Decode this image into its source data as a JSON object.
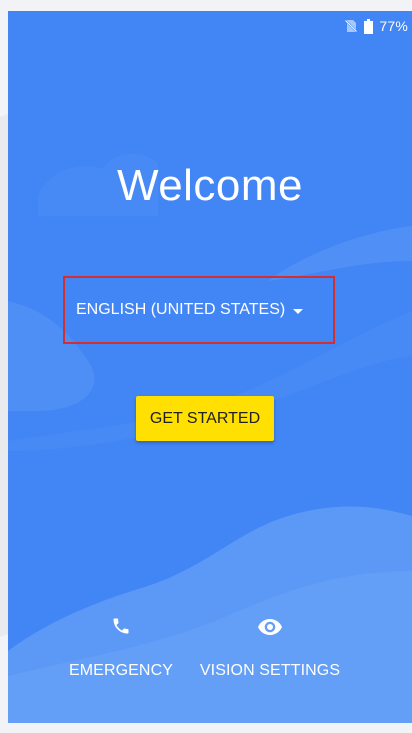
{
  "status_bar": {
    "icons": [
      "no-sim-icon",
      "battery-icon"
    ],
    "battery_percent": "77%"
  },
  "welcome": {
    "title": "Welcome"
  },
  "language": {
    "selected": "ENGLISH (UNITED STATES)",
    "icon": "dropdown-caret-icon"
  },
  "actions": {
    "get_started": "GET STARTED",
    "emergency": {
      "label": "EMERGENCY",
      "icon": "phone-icon"
    },
    "vision_settings": {
      "label": "VISION SETTINGS",
      "icon": "eye-icon"
    }
  },
  "colors": {
    "background": "#4285f4",
    "button": "#ffe000",
    "highlight_box": "#d32f2f"
  }
}
